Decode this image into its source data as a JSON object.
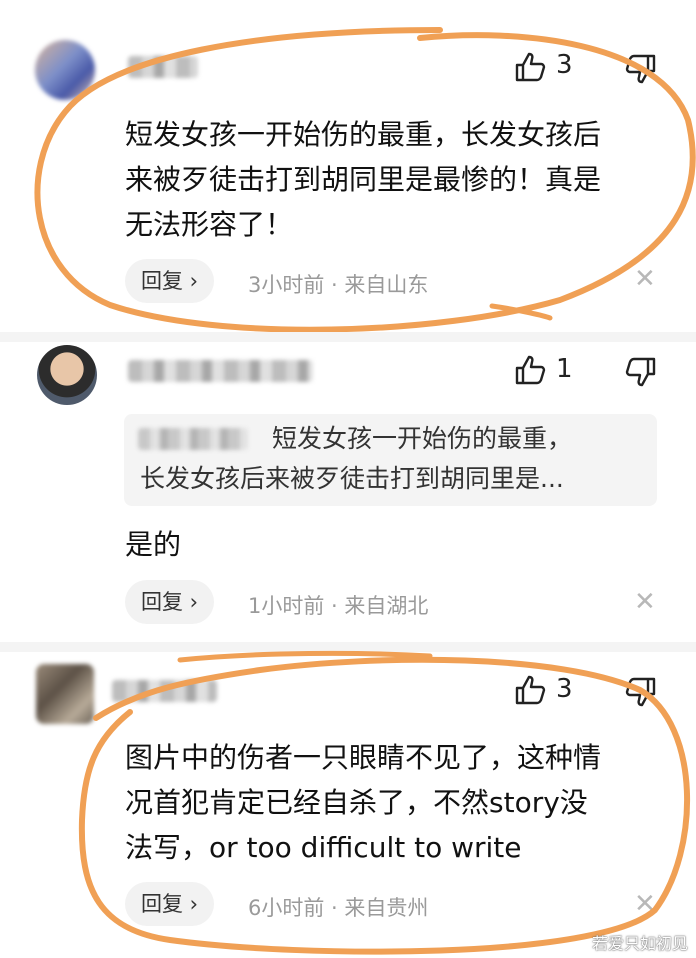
{
  "comments": [
    {
      "likes": "3",
      "text_lines": [
        "短发女孩一开始伤的最重，长发女孩后",
        "来被歹徒击打到胡同里是最惨的！真是",
        "无法形容了！"
      ],
      "reply_label": "回复 ›",
      "meta": "3小时前 · 来自山东",
      "highlighted": true
    },
    {
      "likes": "1",
      "quote_lines": [
        "短发女孩一开始伤的最重，",
        "长发女孩后来被歹徒击打到胡同里是..."
      ],
      "text_lines": [
        "是的"
      ],
      "reply_label": "回复 ›",
      "meta": "1小时前 · 来自湖北",
      "highlighted": false
    },
    {
      "likes": "3",
      "text_lines": [
        "图片中的伤者一只眼睛不见了，这种情",
        "况首犯肯定已经自杀了，不然story没",
        "法写，or too difficult to write"
      ],
      "reply_label": "回复 ›",
      "meta": "6小时前 · 来自贵州",
      "highlighted": true
    }
  ],
  "icons": {
    "like": "thumbs-up-icon",
    "dislike": "thumbs-down-icon",
    "close": "close-icon"
  },
  "colors": {
    "highlight": "#f0a055",
    "meta_text": "#9a9a9a",
    "reply_bg": "#f2f2f2"
  },
  "watermark": "若爱只如初见"
}
